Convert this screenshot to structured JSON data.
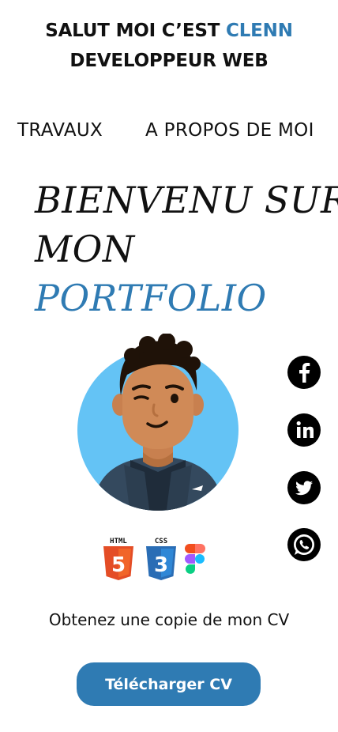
{
  "header": {
    "line1_prefix": "SALUT MOI C’EST",
    "line1_name": "CLENN",
    "line2": "DEVELOPPEUR WEB"
  },
  "nav": {
    "items": [
      {
        "label": "TRAVAUX"
      },
      {
        "label": "A PROPOS DE MOI"
      }
    ]
  },
  "hero": {
    "line1": "BIENVENU SUR",
    "line2": "MON",
    "line3": "PORTFOLIO"
  },
  "social_icons": [
    "facebook-icon",
    "linkedin-icon",
    "twitter-icon",
    "whatsapp-icon"
  ],
  "tech_icons": [
    {
      "icon": "html5-icon",
      "label": "HTML",
      "badge": "5"
    },
    {
      "icon": "css3-icon",
      "label": "CSS",
      "badge": "3"
    },
    {
      "icon": "figma-icon"
    }
  ],
  "cv": {
    "text": "Obtenez une copie de mon CV",
    "button_label": "Télécharger CV"
  },
  "colors": {
    "accent": "#2f7bb3",
    "html5": "#e44d26",
    "css3": "#2a6db5",
    "avatar_bg": "#64c3f5"
  }
}
